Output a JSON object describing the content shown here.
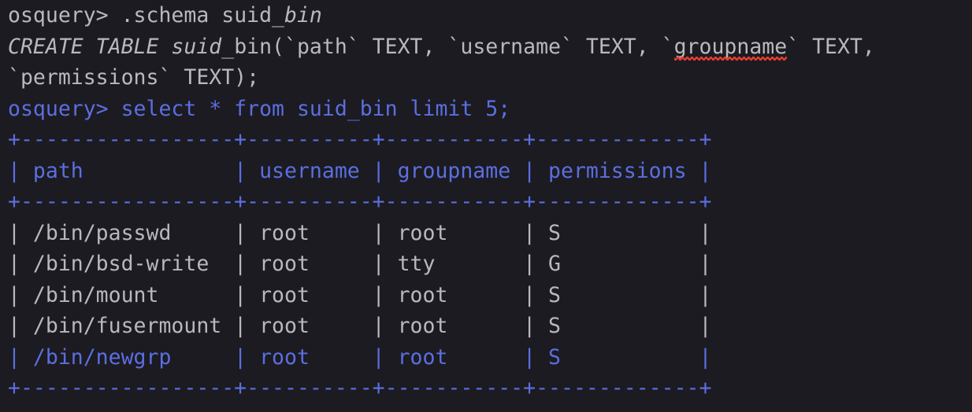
{
  "terminal": {
    "background_color": "#1b1b21",
    "text_color": "#b9b9bd",
    "accent_color": "#5c6ee0",
    "spell_error_color": "#e03a2f",
    "prompt": "osquery>",
    "lines": [
      {
        "id": "line-schema-command",
        "text": "osquery> .schema suid_bin",
        "color": "#b9b9bd"
      },
      {
        "id": "line-create-table-1",
        "text": "CREATE TABLE suid_bin(`path` TEXT, `username` TEXT, `groupname` TEXT,",
        "color": "#b9b9bd"
      },
      {
        "id": "line-create-table-2",
        "text": "`permissions` TEXT);",
        "color": "#b9b9bd"
      },
      {
        "id": "line-select-command",
        "text": "osquery> select * from suid_bin limit 5;",
        "color": "#5c6ee0"
      }
    ],
    "schema_command": {
      "prompt": "osquery> ",
      "dot_command": ".schema ",
      "table_prefix": "suid_",
      "table_suffix": "bin"
    },
    "create_statement": {
      "keyword_part": "CREATE TABLE suid_",
      "after_italic": "bin(`path` TEXT, `username` TEXT, `",
      "misspelled_word": "groupname",
      "tail": "` TEXT,",
      "second_line": "`permissions` TEXT);"
    },
    "select_statement": {
      "prompt": "osquery> ",
      "query": "select * from suid_bin limit 5;"
    }
  },
  "table": {
    "border_color": "#5c6ee0",
    "separator_top": "+-----------------+----------+-----------+-------------+",
    "separator_mid": "+-----------------+----------+-----------+-------------+",
    "separator_bottom": "+-----------------+----------+-----------+-------------+",
    "header_row": "| path            | username | groupname | permissions |",
    "columns": [
      {
        "name": "path",
        "label": "path",
        "width": 17
      },
      {
        "name": "username",
        "label": "username",
        "width": 10
      },
      {
        "name": "groupname",
        "label": "groupname",
        "width": 11
      },
      {
        "name": "permissions",
        "label": "permissions",
        "width": 13
      }
    ],
    "rows": [
      {
        "name": "row-passwd",
        "text": "| /bin/passwd     | root     | root      | S           |",
        "path": "/bin/passwd",
        "username": "root",
        "groupname": "root",
        "permissions": "S",
        "color": "#b9b9bd",
        "highlighted": false
      },
      {
        "name": "row-bsd-write",
        "text": "| /bin/bsd-write  | root     | tty       | G           |",
        "path": "/bin/bsd-write",
        "username": "root",
        "groupname": "tty",
        "permissions": "G",
        "color": "#b9b9bd",
        "highlighted": false
      },
      {
        "name": "row-mount",
        "text": "| /bin/mount      | root     | root      | S           |",
        "path": "/bin/mount",
        "username": "root",
        "groupname": "root",
        "permissions": "S",
        "color": "#b9b9bd",
        "highlighted": false
      },
      {
        "name": "row-fusermount",
        "text": "| /bin/fusermount | root     | root      | S           |",
        "path": "/bin/fusermount",
        "username": "root",
        "groupname": "root",
        "permissions": "S",
        "color": "#b9b9bd",
        "highlighted": false
      },
      {
        "name": "row-newgrp",
        "text": "| /bin/newgrp     | root     | root      | S           |",
        "path": "/bin/newgrp",
        "username": "root",
        "groupname": "root",
        "permissions": "S",
        "color": "#5c6ee0",
        "highlighted": true
      }
    ],
    "row_count": 5
  }
}
